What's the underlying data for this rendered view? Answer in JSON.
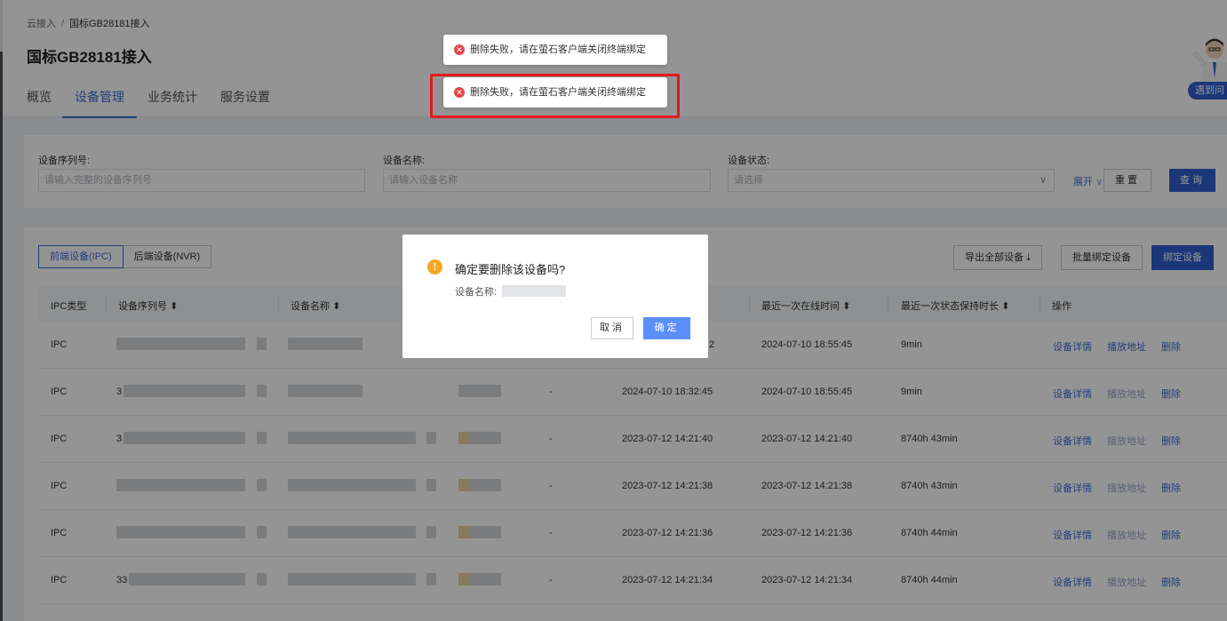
{
  "breadcrumb": {
    "root": "云接入",
    "separator": "/",
    "current": "国标GB28181接入"
  },
  "page_title": "国标GB28181接入",
  "tabs": [
    {
      "label": "概览",
      "active": false
    },
    {
      "label": "设备管理",
      "active": true
    },
    {
      "label": "业务统计",
      "active": false
    },
    {
      "label": "服务设置",
      "active": false
    }
  ],
  "helper_button": "遇到问",
  "filters": {
    "serial": {
      "label": "设备序列号:",
      "placeholder": "请输入完整的设备序列号"
    },
    "name": {
      "label": "设备名称:",
      "placeholder": "请输入设备名称"
    },
    "status": {
      "label": "设备状态:",
      "placeholder": "请选择"
    },
    "expand": "展开",
    "reset": "重置",
    "query": "查询"
  },
  "segment": {
    "front": "前端设备(IPC)",
    "back": "后端设备(NVR)"
  },
  "toolbar": {
    "export": "导出全部设备",
    "batch_bind": "批量绑定设备",
    "bind": "绑定设备"
  },
  "columns": {
    "type": "IPC类型",
    "serial": "设备序列号",
    "name": "设备名称",
    "last_online": "最近一次在线时间",
    "duration": "最近一次状态保持时长",
    "ops": "操作"
  },
  "rows": [
    {
      "type": "IPC",
      "serial_prefix": "",
      "dash": "",
      "reg_time": "2",
      "last_online": "2024-07-10 18:55:45",
      "duration": "9min",
      "play_enabled": true
    },
    {
      "type": "IPC",
      "serial_prefix": "3",
      "dash": "-",
      "reg_time": "2024-07-10 18:32:45",
      "last_online": "2024-07-10 18:55:45",
      "duration": "9min",
      "play_enabled": false
    },
    {
      "type": "IPC",
      "serial_prefix": "3",
      "dash": "-",
      "reg_time": "2023-07-12 14:21:40",
      "last_online": "2023-07-12 14:21:40",
      "duration": "8740h 43min",
      "play_enabled": false
    },
    {
      "type": "IPC",
      "serial_prefix": "",
      "dash": "-",
      "reg_time": "2023-07-12 14:21:38",
      "last_online": "2023-07-12 14:21:38",
      "duration": "8740h 43min",
      "play_enabled": false
    },
    {
      "type": "IPC",
      "serial_prefix": "",
      "dash": "-",
      "reg_time": "2023-07-12 14:21:36",
      "last_online": "2023-07-12 14:21:36",
      "duration": "8740h 44min",
      "play_enabled": false
    },
    {
      "type": "IPC",
      "serial_prefix": "33",
      "dash": "-",
      "reg_time": "2023-07-12 14:21:34",
      "last_online": "2023-07-12 14:21:34",
      "duration": "8740h 44min",
      "play_enabled": false
    }
  ],
  "row_ops": {
    "detail": "设备详情",
    "play": "播放地址",
    "delete": "删除"
  },
  "toasts": [
    {
      "message": "删除失败，请在萤石客户端关闭终端绑定"
    },
    {
      "message": "删除失败，请在萤石客户端关闭终端绑定"
    }
  ],
  "dialog": {
    "title": "确定要删除该设备吗?",
    "name_label": "设备名称:",
    "cancel": "取消",
    "confirm": "确定"
  },
  "colors": {
    "primary": "#2f5fd0",
    "link": "#3b6fd8",
    "error": "#e5494a",
    "warning": "#f5a623",
    "highlight": "#e5191c"
  }
}
